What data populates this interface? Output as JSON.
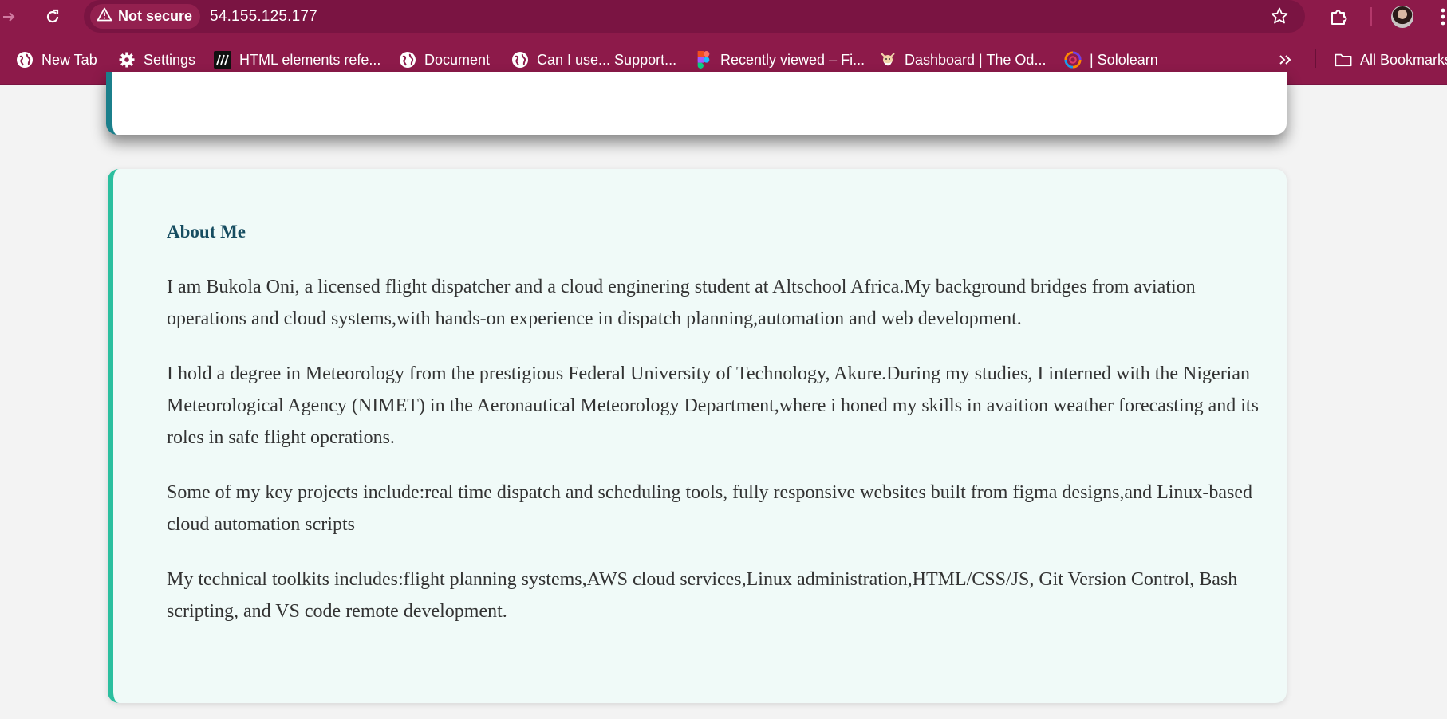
{
  "browser": {
    "security_label": "Not secure",
    "url": "54.155.125.177",
    "icons": {
      "forward": "arrow-right-icon",
      "reload": "reload-icon",
      "warning": "warning-triangle-icon",
      "bookmark_star": "star-icon",
      "extensions": "puzzle-icon",
      "menu": "kebab-menu-icon",
      "profile": "avatar"
    }
  },
  "bookmarks": {
    "items": [
      {
        "label": "New Tab",
        "icon": "globe-icon"
      },
      {
        "label": "Settings",
        "icon": "gear-icon"
      },
      {
        "label": "HTML elements refe...",
        "icon": "mdn-icon"
      },
      {
        "label": "Document",
        "icon": "globe-icon"
      },
      {
        "label": "Can I use... Support...",
        "icon": "globe-icon"
      },
      {
        "label": "Recently viewed – Fi...",
        "icon": "figma-icon"
      },
      {
        "label": "Dashboard | The Od...",
        "icon": "odin-icon"
      },
      {
        "label": "| Sololearn",
        "icon": "sololearn-icon"
      }
    ],
    "overflow_icon": "chevron-double-right-icon",
    "all_bookmarks": "All Bookmarks"
  },
  "about": {
    "title": "About Me",
    "paragraphs": [
      "I am Bukola Oni, a licensed flight dispatcher and a cloud enginering student at Altschool Africa.My background bridges from aviation operations and cloud systems,with hands-on experience in dispatch planning,automation and web development.",
      "I hold a degree in Meteorology from the prestigious Federal University of Technology, Akure.During my studies, I interned with the Nigerian Meteorological Agency (NIMET) in the Aeronautical Meteorology Department,where i honed my skills in avaition weather forecasting and its roles in safe flight operations.",
      "Some of my key projects include:real time dispatch and scheduling tools, fully responsive websites built from figma designs,and Linux-based cloud automation scripts",
      "My technical toolkits includes:flight planning systems,AWS cloud services,Linux administration,HTML/CSS/JS, Git Version Control, Bash scripting, and VS code remote development."
    ]
  },
  "colors": {
    "chrome": "#8d1a4a",
    "omnibox": "#7a1442",
    "page_bg": "#f3f3f3",
    "card_accent": "#2bbf9f",
    "top_card_accent": "#1b7f8b",
    "heading": "#174d61",
    "text": "#333333"
  }
}
